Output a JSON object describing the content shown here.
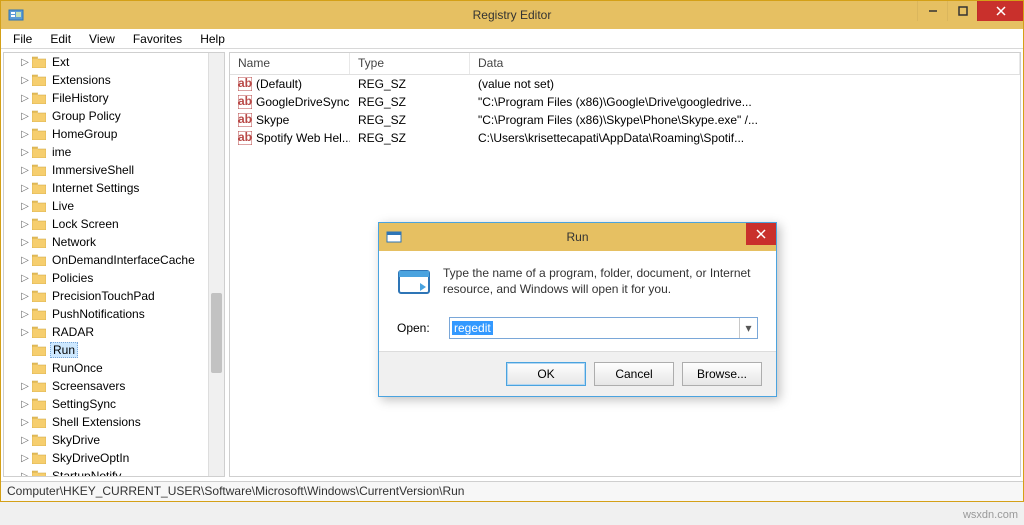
{
  "window": {
    "title": "Registry Editor",
    "menu": [
      "File",
      "Edit",
      "View",
      "Favorites",
      "Help"
    ],
    "status": "Computer\\HKEY_CURRENT_USER\\Software\\Microsoft\\Windows\\CurrentVersion\\Run"
  },
  "tree": {
    "items": [
      {
        "label": "Ext"
      },
      {
        "label": "Extensions"
      },
      {
        "label": "FileHistory"
      },
      {
        "label": "Group Policy"
      },
      {
        "label": "HomeGroup"
      },
      {
        "label": "ime"
      },
      {
        "label": "ImmersiveShell"
      },
      {
        "label": "Internet Settings"
      },
      {
        "label": "Live"
      },
      {
        "label": "Lock Screen"
      },
      {
        "label": "Network"
      },
      {
        "label": "OnDemandInterfaceCache"
      },
      {
        "label": "Policies"
      },
      {
        "label": "PrecisionTouchPad"
      },
      {
        "label": "PushNotifications"
      },
      {
        "label": "RADAR"
      },
      {
        "label": "Run",
        "selected": true,
        "leaf": true
      },
      {
        "label": "RunOnce",
        "leaf": true
      },
      {
        "label": "Screensavers"
      },
      {
        "label": "SettingSync"
      },
      {
        "label": "Shell Extensions"
      },
      {
        "label": "SkyDrive"
      },
      {
        "label": "SkyDriveOptIn"
      },
      {
        "label": "StartupNotify"
      }
    ]
  },
  "list": {
    "columns": [
      "Name",
      "Type",
      "Data"
    ],
    "rows": [
      {
        "name": "(Default)",
        "type": "REG_SZ",
        "data": "(value not set)"
      },
      {
        "name": "GoogleDriveSync",
        "type": "REG_SZ",
        "data": "\"C:\\Program Files (x86)\\Google\\Drive\\googledrive..."
      },
      {
        "name": "Skype",
        "type": "REG_SZ",
        "data": "\"C:\\Program Files (x86)\\Skype\\Phone\\Skype.exe\" /..."
      },
      {
        "name": "Spotify Web Hel...",
        "type": "REG_SZ",
        "data": "C:\\Users\\krisettecapati\\AppData\\Roaming\\Spotif..."
      }
    ]
  },
  "run": {
    "title": "Run",
    "desc": "Type the name of a program, folder, document, or Internet resource, and Windows will open it for you.",
    "open_label": "Open:",
    "value": "regedit",
    "ok": "OK",
    "cancel": "Cancel",
    "browse": "Browse..."
  },
  "watermark": "wsxdn.com"
}
